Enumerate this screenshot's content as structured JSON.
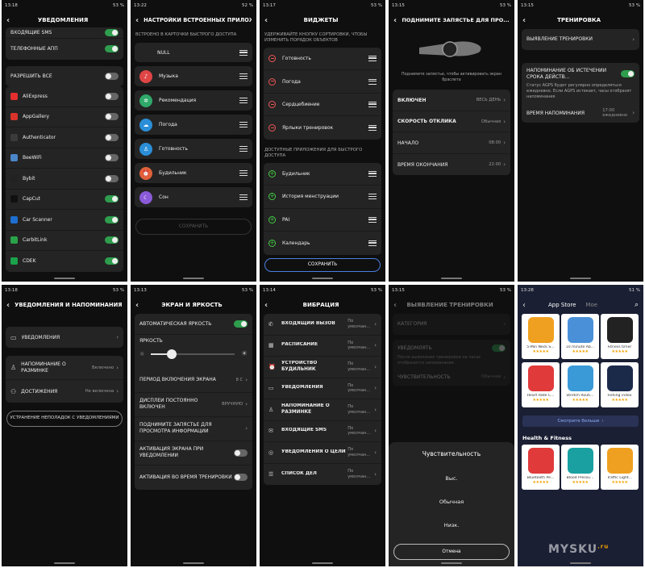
{
  "s1": {
    "status_time": "13:18",
    "battery": "53 %",
    "title": "УВЕДОМЛЕНИЯ",
    "top_rows": [
      {
        "label": "ВХОДЯЩИЕ SMS"
      },
      {
        "label": "ТЕЛЕФОННЫЕ АПП"
      }
    ],
    "allow_all": "РАЗРЕШИТЬ ВСЁ",
    "apps": [
      {
        "label": "AliExpress",
        "on": false,
        "color": "#e52e2e"
      },
      {
        "label": "AppGallery",
        "on": false,
        "color": "#d9342b"
      },
      {
        "label": "Authenticator",
        "on": false,
        "color": "#3b3b3b"
      },
      {
        "label": "BeeWiFi",
        "on": false,
        "color": "#4a86c8"
      },
      {
        "label": "Bybit",
        "on": false,
        "color": "#222"
      },
      {
        "label": "CapCut",
        "on": true,
        "color": "#111"
      },
      {
        "label": "Car Scanner",
        "on": true,
        "color": "#1e6fd0"
      },
      {
        "label": "CarbitLink",
        "on": true,
        "color": "#2aa24a"
      },
      {
        "label": "CDEK",
        "on": true,
        "color": "#1aa34a"
      }
    ]
  },
  "s2": {
    "status_time": "13:22",
    "battery": "52 %",
    "title": "НАСТРОЙКИ ВСТРОЕННЫХ ПРИЛОЖЕНИЙ",
    "section": "ВСТРОЕНО В КАРТОЧКИ БЫСТРОГО ДОСТУПА",
    "null_label": "NULL",
    "items": [
      {
        "label": "Музыка",
        "color": "#e04545",
        "glyph": "♪"
      },
      {
        "label": "Рекомендация",
        "color": "#2fa86a",
        "glyph": "✲"
      },
      {
        "label": "Погода",
        "color": "#2a8fd8",
        "glyph": "☁"
      },
      {
        "label": "Готовность",
        "color": "#2a8fd8",
        "glyph": "♙"
      },
      {
        "label": "Будильник",
        "color": "#e0603a",
        "glyph": "⏰"
      },
      {
        "label": "Сон",
        "color": "#8a5ad8",
        "glyph": "☾"
      }
    ],
    "save": "СОХРАНИТЬ"
  },
  "s3": {
    "status_time": "13:17",
    "battery": "53 %",
    "title": "ВИДЖЕТЫ",
    "hint": "УДЕРЖИВАЙТЕ КНОПКУ СОРТИРОВКИ, ЧТОБЫ ИЗМЕНИТЬ ПОРЯДОК ОБЪЕКТОВ",
    "widgets": [
      "Готовность",
      "Погода",
      "Сердцебиение",
      "Ярлыки тренировок"
    ],
    "available_title": "ДОСТУПНЫЕ ПРИЛОЖЕНИЯ ДЛЯ БЫСТРОГО ДОСТУПА",
    "available": [
      "Будильник",
      "История менструации",
      "PAI",
      "Календарь"
    ],
    "save": "СОХРАНИТЬ"
  },
  "s4": {
    "status_time": "13:15",
    "battery": "53 %",
    "title": "ПОДНИМИТЕ ЗАПЯСТЬЕ ДЛЯ ПРО...",
    "caption": "Поднимите запястье, чтобы активировать экран браслета",
    "rows": [
      {
        "label": "ВКЛЮЧЕН",
        "value": "ВЕСЬ ДЕНЬ"
      },
      {
        "label": "СКОРОСТЬ ОТКЛИКА",
        "value": "Обычная"
      },
      {
        "label": "НАЧАЛО",
        "value": "08:00"
      },
      {
        "label": "ВРЕМЯ ОКОНЧАНИЯ",
        "value": "22:00"
      }
    ]
  },
  "s5": {
    "status_time": "13:15",
    "battery": "53 %",
    "title": "ТРЕНИРОВКА",
    "detect": "ВЫЯВЛЕНИЕ ТРЕНИРОВКИ",
    "reminder": "НАПОМИНАНИЕ ОБ ИСТЕЧЕНИИ СРОКА ДЕЙСТВ...",
    "reminder_desc": "Статус AGPS будет регулярно определяться ежедневно. Если AGPS истекает, часы отобразят напоминание",
    "time_label": "ВРЕМЯ НАПОМИНАНИЯ",
    "time_value": "17:00 ежедневно"
  },
  "s6": {
    "status_time": "13:18",
    "battery": "53 %",
    "title": "УВЕДОМЛЕНИЯ И НАПОМИНАНИЯ",
    "notif": "УВЕДОМЛЕНИЯ",
    "warmup": "НАПОМИНАНИЕ О РАЗМИНКЕ",
    "warmup_val": "Включено",
    "achv": "ДОСТИЖЕНИЯ",
    "achv_val": "Не включена",
    "fix": "УСТРАНЕНИЕ НЕПОЛАДОК С УВЕДОМЛЕНИЯМИ"
  },
  "s7": {
    "status_time": "13:13",
    "battery": "53 %",
    "title": "ЭКРАН И ЯРКОСТЬ",
    "auto": "АВТОМАТИЧЕСКАЯ ЯРКОСТЬ",
    "bright": "ЯРКОСТЬ",
    "brightness_level": 0.25,
    "period": "ПЕРИОД ВКЛЮЧЕНИЯ ЭКРАНА",
    "period_val": "8 С",
    "aod": "ДИСПЛЕЙ ПОСТОЯННО ВКЛЮЧЕН",
    "aod_val": "ВРУЧНУЮ",
    "raise": "ПОДНИМИТЕ ЗАПЯСТЬЕ ДЛЯ ПРОСМОТРА ИНФОРМАЦИИ",
    "act_notif": "АКТИВАЦИЯ ЭКРАНА ПРИ УВЕДОМЛЕНИИ",
    "act_train": "АКТИВАЦИЯ ВО ВРЕМЯ ТРЕНИРОВКИ"
  },
  "s8": {
    "status_time": "13:14",
    "battery": "53 %",
    "title": "ВИБРАЦИЯ",
    "default_val": "По умолчан...",
    "items": [
      {
        "label": "ВХОДЯЩИЙ ВЫЗОВ",
        "icon": "✆"
      },
      {
        "label": "РАСПИСАНИЕ",
        "icon": "▦"
      },
      {
        "label": "УСТРОЙСТВО БУДИЛЬНИК",
        "icon": "⏰"
      },
      {
        "label": "УВЕДОМЛЕНИЯ",
        "icon": "▭"
      },
      {
        "label": "НАПОМИНАНИЕ О РАЗМИНКЕ",
        "icon": "♙"
      },
      {
        "label": "ВХОДЯЩИЕ SMS",
        "icon": "✉"
      },
      {
        "label": "УВЕДОМЛЕНИЯ О ЦЕЛИ",
        "icon": "◎"
      },
      {
        "label": "СПИСОК ДЕЛ",
        "icon": "☰"
      }
    ]
  },
  "s9": {
    "status_time": "13:15",
    "battery": "53 %",
    "title": "ВЫЯВЛЕНИЕ ТРЕНИРОВКИ",
    "category": "КАТЕГОРИЯ",
    "notify": "УВЕДОМЛЯТЬ",
    "notify_desc": "После выявления тренировки на часах отобразится напоминание",
    "sens": "ЧУВСТВИТЕЛЬНОСТЬ",
    "sens_val": "Обычная",
    "sheet_title": "Чувствительность",
    "opts": [
      "Выс.",
      "Обычная",
      "Низк."
    ],
    "cancel": "Отмена"
  },
  "s10": {
    "status_time": "13:28",
    "battery": "51 %",
    "tab_store": "App Store",
    "tab_mine": "Мое",
    "more": "Смотрите больше",
    "section": "Health & Fitness",
    "apps": [
      {
        "name": "5-Min Neck S...",
        "bg": "#f0a020"
      },
      {
        "name": "10 minute Ab...",
        "bg": "#4a90d8"
      },
      {
        "name": "Fitness timer",
        "bg": "#222"
      },
      {
        "name": "Heart Rate C...",
        "bg": "#e03a3a"
      },
      {
        "name": "Stretch Routi...",
        "bg": "#3a9ad8"
      },
      {
        "name": "Fishing index",
        "bg": "#1c2a4a"
      }
    ],
    "health": [
      {
        "name": "Bluetooth Pe...",
        "bg": "#e03a3a"
      },
      {
        "name": "Blood Pressu...",
        "bg": "#1aa0a0"
      },
      {
        "name": "Traffic Light...",
        "bg": "#f0a020"
      }
    ],
    "stars": "★★★★★",
    "watermark": "MYSKU",
    "watermark_tld": ".ru"
  }
}
